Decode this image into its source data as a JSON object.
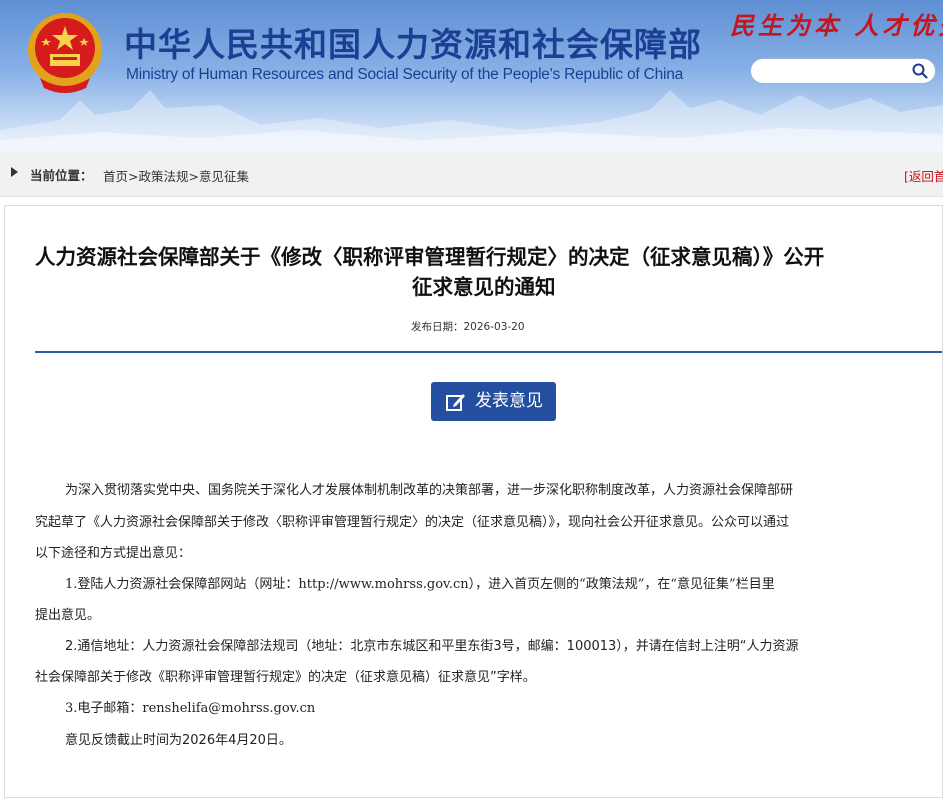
{
  "header": {
    "title_cn": "中华人民共和国人力资源和社会保障部",
    "title_en": "Ministry of Human Resources and Social Security of the People's Republic of China",
    "motto": "民生为本 人才优先",
    "search": {
      "placeholder": "",
      "icon": "search-icon"
    },
    "emblem": "national-emblem-icon"
  },
  "breadcrumb": {
    "label": "当前位置：",
    "items": [
      "首页",
      "政策法规",
      "意见征集"
    ],
    "separator": ">",
    "back": "[返回首"
  },
  "article": {
    "title_line1": "人力资源社会保障部关于《修改〈职称评审管理暂行规定〉的决定（征求意见稿）》公开",
    "title_line2": "征求意见的通知",
    "date": "发布日期：2026-03-20",
    "comment_button": "发表意见",
    "paragraphs": [
      "为深入贯彻落实党中央、国务院关于深化人才发展体制机制改革的决策部署，进一步深化职称制度改革，人力资源社会保障部研",
      "究起草了《人力资源社会保障部关于修改〈职称评审管理暂行规定〉的决定（征求意见稿）》，现向社会公开征求意见。公众可以通过",
      "以下途径和方式提出意见：",
      "1.登陆人力资源社会保障部网站（网址：http://www.mohrss.gov.cn），进入首页左侧的“政策法规”，在“意见征集”栏目里",
      "提出意见。",
      "2.通信地址：人力资源社会保障部法规司（地址：北京市东城区和平里东街3号，邮编：100013），并请在信封上注明“人力资源",
      "社会保障部关于修改《职称评审管理暂行规定》的决定（征求意见稿）征求意见”字样。",
      "3.电子邮箱：renshelifa@mohrss.gov.cn",
      "意见反馈截止时间为2026年4月20日。"
    ]
  },
  "colors": {
    "header_blue": "#1b3f93",
    "motto_red": "#c8141b",
    "button_blue": "#244ea0",
    "divider_blue": "#2d5ba8"
  }
}
